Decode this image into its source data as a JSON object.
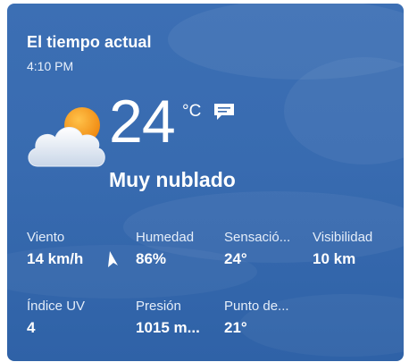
{
  "header": {
    "title": "El tiempo actual",
    "time": "4:10 PM"
  },
  "current": {
    "temperature": "24",
    "unit": "°C",
    "condition": "Muy nublado",
    "icon": "mostly-cloudy-icon"
  },
  "metrics": [
    {
      "label": "Viento",
      "value": "14 km/h"
    },
    {
      "label": "Humedad",
      "value": "86%"
    },
    {
      "label": "Sensació...",
      "value": "24°"
    },
    {
      "label": "Visibilidad",
      "value": "10 km"
    },
    {
      "label": "Índice UV",
      "value": "4"
    },
    {
      "label": "Presión",
      "value": "1015 m..."
    },
    {
      "label": "Punto de...",
      "value": "21°"
    }
  ],
  "colors": {
    "card_background": "#386bb0",
    "text": "#ffffff",
    "sun": "#f39a1c"
  }
}
